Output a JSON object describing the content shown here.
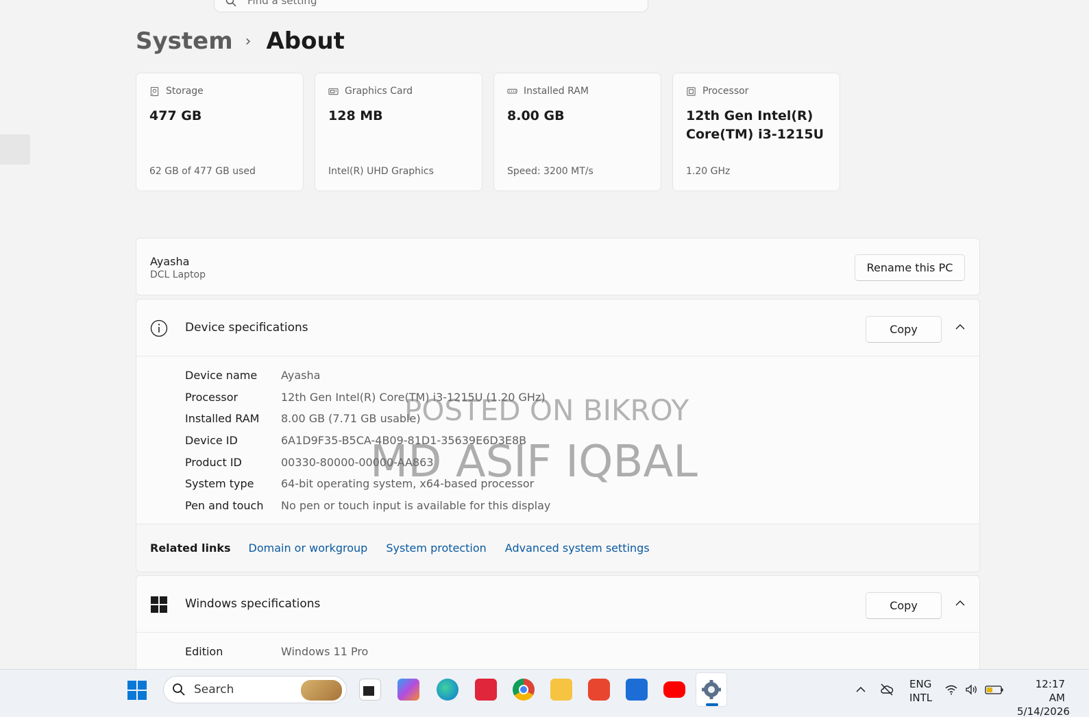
{
  "search": {
    "placeholder": "Find a setting"
  },
  "breadcrumb": {
    "parent": "System",
    "separator": "›",
    "current": "About"
  },
  "cards": [
    {
      "label": "Storage",
      "value": "477 GB",
      "sub": "62 GB of 477 GB used",
      "icon": "storage-icon"
    },
    {
      "label": "Graphics Card",
      "value": "128 MB",
      "sub": "Intel(R) UHD Graphics",
      "icon": "graphics-card-icon"
    },
    {
      "label": "Installed RAM",
      "value": "8.00 GB",
      "sub": "Speed: 3200 MT/s",
      "icon": "ram-icon"
    },
    {
      "label": "Processor",
      "value": "12th Gen Intel(R) Core(TM) i3-1215U",
      "sub": "1.20 GHz",
      "icon": "processor-icon"
    }
  ],
  "pc": {
    "name": "Ayasha",
    "model": "DCL Laptop",
    "rename_label": "Rename this PC"
  },
  "device_specs": {
    "title": "Device specifications",
    "copy_label": "Copy",
    "rows": [
      {
        "label": "Device name",
        "value": "Ayasha"
      },
      {
        "label": "Processor",
        "value": "12th Gen Intel(R) Core(TM) i3-1215U (1.20 GHz)"
      },
      {
        "label": "Installed RAM",
        "value": "8.00 GB (7.71 GB usable)"
      },
      {
        "label": "Device ID",
        "value": "6A1D9F35-B5CA-4B09-81D1-35639E6D3E8B"
      },
      {
        "label": "Product ID",
        "value": "00330-80000-00000-AA863"
      },
      {
        "label": "System type",
        "value": "64-bit operating system, x64-based processor"
      },
      {
        "label": "Pen and touch",
        "value": "No pen or touch input is available for this display"
      }
    ]
  },
  "related_links": {
    "label": "Related links",
    "links": [
      "Domain or workgroup",
      "System protection",
      "Advanced system settings"
    ]
  },
  "windows_specs": {
    "title": "Windows specifications",
    "copy_label": "Copy",
    "rows": [
      {
        "label": "Edition",
        "value": "Windows 11 Pro"
      }
    ]
  },
  "watermark": {
    "line1": "POSTED ON BIKROY",
    "line2": "MD ASIF IQBAL"
  },
  "taskbar": {
    "search_label": "Search",
    "lang_1": "ENG",
    "lang_2": "INTL",
    "time": "12:17 AM",
    "date": "5/14/2026"
  },
  "colors": {
    "accent": "#0067c0",
    "link": "#0a5aa0"
  }
}
